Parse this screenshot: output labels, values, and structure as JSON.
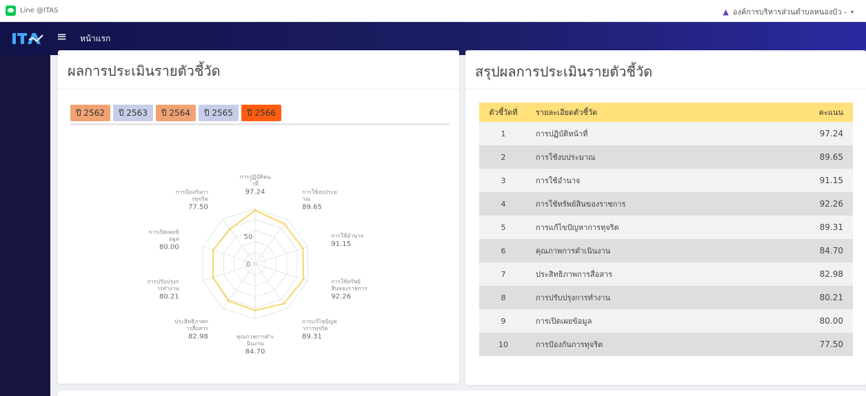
{
  "topbar": {
    "line_label": "Line @ITAS",
    "org_name": "องค์การบริหารส่วนตำบลหนองบัว -",
    "caret": "▾"
  },
  "navbar": {
    "menu_icon": "hamburger-icon",
    "menu_glyph": "≡",
    "home_label": "หน้าแรก"
  },
  "left_card": {
    "title": "ผลการประเมินรายตัวชี้วัด",
    "years": [
      {
        "label": "ปี 2562",
        "color": "#f1a272"
      },
      {
        "label": "ปี 2563",
        "color": "#c7cde9"
      },
      {
        "label": "ปี 2564",
        "color": "#f1a272"
      },
      {
        "label": "ปี 2565",
        "color": "#c7cde9"
      },
      {
        "label": "ปี 2566",
        "color": "#ff5e10"
      }
    ]
  },
  "right_card": {
    "title": "สรุปผลการประเมินรายตัวชี้วัด",
    "columns": [
      "ตัวชี้วัดที่",
      "รายละเอียดตัวชี้วัด",
      "คะแนน"
    ],
    "rows": [
      {
        "no": "1",
        "name": "การปฏิบัติหน้าที่",
        "score": "97.24"
      },
      {
        "no": "2",
        "name": "การใช้งบประมาณ",
        "score": "89.65"
      },
      {
        "no": "3",
        "name": "การใช้อำนาจ",
        "score": "91.15"
      },
      {
        "no": "4",
        "name": "การใช้ทรัพย์สินของราชการ",
        "score": "92.26"
      },
      {
        "no": "5",
        "name": "การแก้ไขปัญหาการทุจริต",
        "score": "89.31"
      },
      {
        "no": "6",
        "name": "คุณภาพการดำเนินงาน",
        "score": "84.70"
      },
      {
        "no": "7",
        "name": "ประสิทธิภาพการสื่อสาร",
        "score": "82.98"
      },
      {
        "no": "8",
        "name": "การปรับปรุงการทำงาน",
        "score": "80.21"
      },
      {
        "no": "9",
        "name": "การเปิดเผยข้อมูล",
        "score": "80.00"
      },
      {
        "no": "10",
        "name": "การป้องกันการทุจริต",
        "score": "77.50"
      }
    ]
  },
  "chart_data": {
    "type": "radar",
    "categories": [
      "การปฏิบัติหน้าที่",
      "การใช้งบประมาณ",
      "การใช้อำนาจ",
      "การใช้ทรัพย์สินของราชการ",
      "การแก้ไขปัญหาการทุจริต",
      "คุณภาพการดำเนินงาน",
      "ประสิทธิภาพการสื่อสาร",
      "การปรับปรุงการทำงาน",
      "การเปิดเผยข้อมูล",
      "การป้องกันการทุจริต"
    ],
    "values": [
      97.24,
      89.65,
      91.15,
      92.26,
      89.31,
      84.7,
      82.98,
      80.21,
      80.0,
      77.5
    ],
    "value_labels": [
      "97.24",
      "89.65",
      "91.15",
      "92.26",
      "89.31",
      "84.70",
      "82.98",
      "80.21",
      "80.00",
      "77.50"
    ],
    "r_ticks": [
      "0",
      "50"
    ],
    "r_range": [
      0,
      100
    ],
    "grid": true,
    "line_color": "#f5d66a",
    "grid_color": "#e6e6e6"
  },
  "colors": {
    "navbar": "#1d1d66",
    "sidebar": "#161640",
    "table_header": "#ffe07a",
    "row_light": "#f2f2f2",
    "row_dark": "#dedede"
  }
}
